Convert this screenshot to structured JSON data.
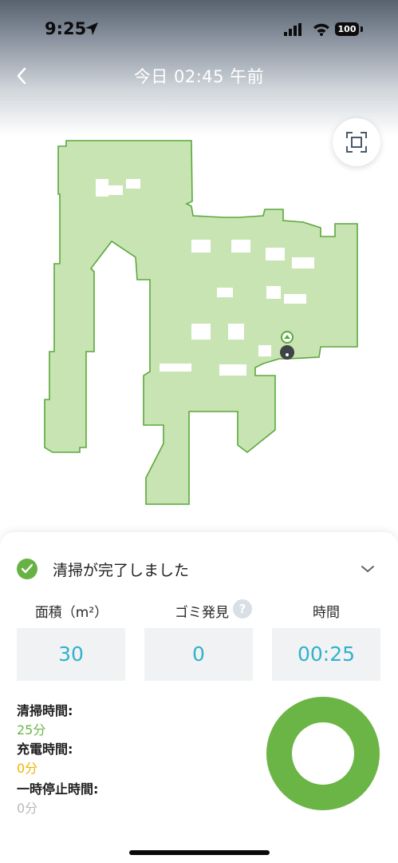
{
  "status_bar": {
    "time": "9:25",
    "battery": "100"
  },
  "header": {
    "title": "今日 02:45 午前"
  },
  "summary": {
    "status_text": "清掃が完了しました",
    "stats": [
      {
        "label": "面積（m²）",
        "value": "30"
      },
      {
        "label": "ゴミ発見",
        "value": "0",
        "help": "?"
      },
      {
        "label": "時間",
        "value": "00:25"
      }
    ],
    "durations": [
      {
        "label": "清掃時間:",
        "value": "25分",
        "color": "#6bb546"
      },
      {
        "label": "充電時間:",
        "value": "0分",
        "color": "#f0b400"
      },
      {
        "label": "一時停止時間:",
        "value": "0分",
        "color": "#b9b9b9"
      }
    ],
    "donut_fraction_cleaning": 1.0
  },
  "colors": {
    "map_fill": "#c9e4b3",
    "map_edge": "#5aa83c",
    "accent_teal": "#2fb2cb"
  }
}
